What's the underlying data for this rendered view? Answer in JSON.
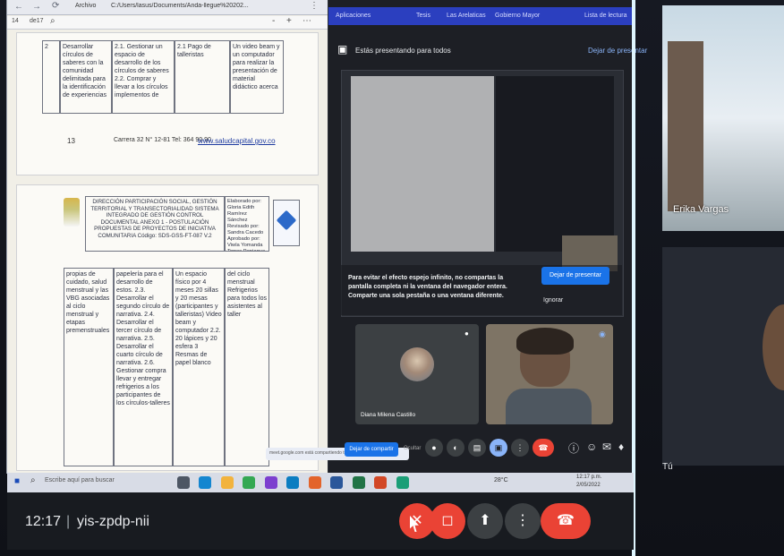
{
  "colors": {
    "meet_bg": "#202124",
    "meet_dark": "#101218",
    "red": "#ea4335",
    "blue": "#1a73e8",
    "doc_bg": "#f1efe7",
    "cyan_line": "#d9f7ff"
  },
  "left_browser": {
    "nav_labels": [
      "Archivo",
      "C:/Users/lasus/Documents/Anda-llegue%20202..."
    ],
    "toolbar_left": "14",
    "toolbar_left2": "de17",
    "zoom_controls": [
      "-",
      "+",
      "⋯"
    ]
  },
  "document_top": {
    "row_number": "2",
    "table": [
      "Desarrollar círculos de saberes con la comunidad delimitada para la identificación de experiencias",
      "2.1. Gestionar un espacio de desarrollo de los círculos de saberes 2.2. Comprar y llevar a los círculos implementos de",
      "2.1 Pago de talleristas",
      "Un video beam y un computador para realizar la presentación de material didáctico acerca"
    ],
    "footer_number": "13",
    "footer_text": "Carrera 32 N° 12-81 Tel: 364 90 90",
    "footer_link": "www.saludcapital.gov.co"
  },
  "document_bottom": {
    "header_title": "DIRECCIÓN PARTICIPACIÓN SOCIAL, GESTIÓN TERRITORIAL Y TRANSECTORIALIDAD SISTEMA INTEGRADO DE GESTIÓN CONTROL DOCUMENTAL ANEXO 1 - POSTULACIÓN PROPUESTAS DE PROYECTOS DE INICIATIVA COMUNITARIA Código: SDS-GSS-FT-087 V.2",
    "header_meta": "Elaborado por: Gloria Edith Ramírez Sánchez Revisado por: Sandra Cacedo Aprobado por: Viwla Yomanda Torres Paniagua",
    "cells": [
      "propias de cuidado, salud menstrual y las VBG asociadas al ciclo menstrual y etapas premenstruales",
      "papelería para el desarrollo de estos. 2.3. Desarrollar el segundo círculo de narrativa. 2.4. Desarrollar el tercer círculo de narrativa. 2.5. Desarrollar el cuarto círculo de narrativa. 2.6. Gestionar compra llevar y entregar refrigerios a los participantes de los círculos-talleres",
      "Un espacio físico por 4 meses   20 sillas y 20 mesas (participantes y talleristas)   Video beam y computador   2.2. 20 lápices y 20 esfera   3 Resmas de papel blanco",
      "del ciclo menstrual   Refrigerios para todos los asistentes al taller"
    ]
  },
  "inner_meet": {
    "bookmarks": [
      "Aplicaciones",
      "Tesis",
      "Las Arelaticas",
      "Gobierno Mayor",
      "Lista de lectura"
    ],
    "presenting_label": "Estás presentando para todos",
    "stop_presenting": "Dejar de presentar",
    "warning_text": "Para evitar el efecto espejo infinito, no compartas la pantalla completa ni la ventana del navegador entera. Comparte una sola pestaña o una ventana diferente.",
    "stop_btn": "Dejar de presentar",
    "ignore_btn": "Ignorar",
    "participant_name": "Diana Milena Castillo",
    "share_bar_text": "meet.google.com está compartiendo tu pantalla",
    "share_stop": "Dejar de compartir",
    "share_hide": "Ocultar"
  },
  "taskbar": {
    "search_placeholder": "Escribe aquí para buscar",
    "temperature": "28°C",
    "time": "12:17 p.m.",
    "date": "2/05/2022"
  },
  "right_panel": {
    "tile_name": "Erika Vargas",
    "self_label": "Tú"
  },
  "bottom_bar": {
    "time": "12:17",
    "separator": "|",
    "meeting_code": "yis-zpdp-nii"
  }
}
